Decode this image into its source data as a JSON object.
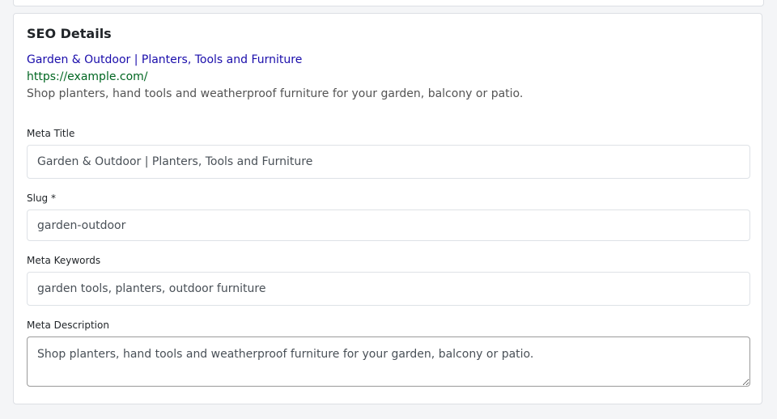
{
  "seo": {
    "heading": "SEO Details",
    "preview": {
      "title": "Garden & Outdoor | Planters, Tools and Furniture",
      "url": "https://example.com/",
      "description": "Shop planters, hand tools and weatherproof furniture for your garden, balcony or patio."
    },
    "fields": {
      "meta_title": {
        "label": "Meta Title",
        "value": "Garden & Outdoor | Planters, Tools and Furniture"
      },
      "slug": {
        "label": "Slug *",
        "value": "garden-outdoor"
      },
      "meta_keywords": {
        "label": "Meta Keywords",
        "value": "garden tools, planters, outdoor furniture"
      },
      "meta_description": {
        "label": "Meta Description",
        "value": "Shop planters, hand tools and weatherproof furniture for your garden, balcony or patio."
      }
    }
  },
  "colors": {
    "link": "#1a0dab",
    "url": "#006621",
    "snippet": "#545454"
  }
}
